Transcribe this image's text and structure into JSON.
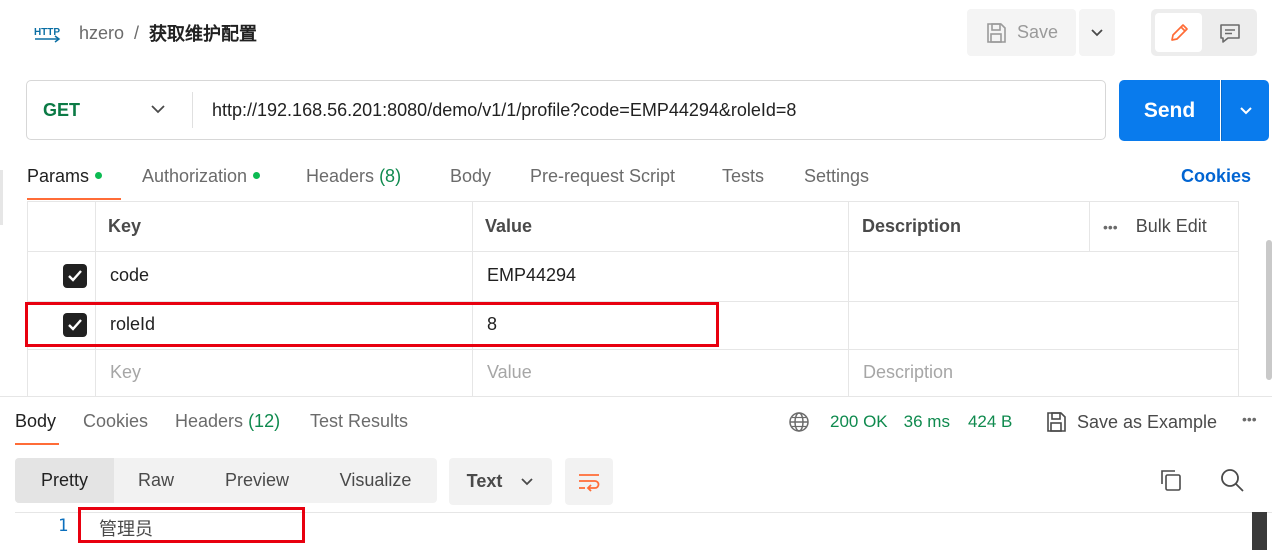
{
  "header": {
    "protocol_icon": "HTTP",
    "workspace": "hzero",
    "separator": "/",
    "title": "获取维护配置",
    "save_label": "Save"
  },
  "request": {
    "method": "GET",
    "url": "http://192.168.56.201:8080/demo/v1/1/profile?code=EMP44294&roleId=8",
    "send_label": "Send"
  },
  "request_tabs": [
    {
      "label": "Params",
      "dot": true
    },
    {
      "label": "Authorization",
      "dot": true
    },
    {
      "label": "Headers",
      "count": "(8)"
    },
    {
      "label": "Body"
    },
    {
      "label": "Pre-request Script"
    },
    {
      "label": "Tests"
    },
    {
      "label": "Settings"
    }
  ],
  "cookies_link": "Cookies",
  "params_table": {
    "headers": {
      "key": "Key",
      "value": "Value",
      "description": "Description",
      "bulk_edit": "Bulk Edit",
      "more": "•••"
    },
    "rows": [
      {
        "checked": true,
        "key": "code",
        "value": "EMP44294",
        "description": ""
      },
      {
        "checked": true,
        "key": "roleId",
        "value": "8",
        "description": ""
      }
    ],
    "placeholder": {
      "key": "Key",
      "value": "Value",
      "description": "Description"
    }
  },
  "response": {
    "tabs": [
      {
        "label": "Body"
      },
      {
        "label": "Cookies"
      },
      {
        "label": "Headers",
        "count": "(12)"
      },
      {
        "label": "Test Results"
      }
    ],
    "status": "200 OK",
    "time": "36 ms",
    "size": "424 B",
    "save_example": "Save as Example",
    "more": "•••",
    "view_modes": [
      "Pretty",
      "Raw",
      "Preview",
      "Visualize"
    ],
    "format": "Text",
    "lines": [
      {
        "number": "1",
        "text": "管理员"
      }
    ]
  },
  "colors": {
    "accent": "#ff6c37",
    "send": "#097bed",
    "status_ok": "#0f8a4e",
    "highlight_box": "#e8000f",
    "link": "#0265d2"
  }
}
